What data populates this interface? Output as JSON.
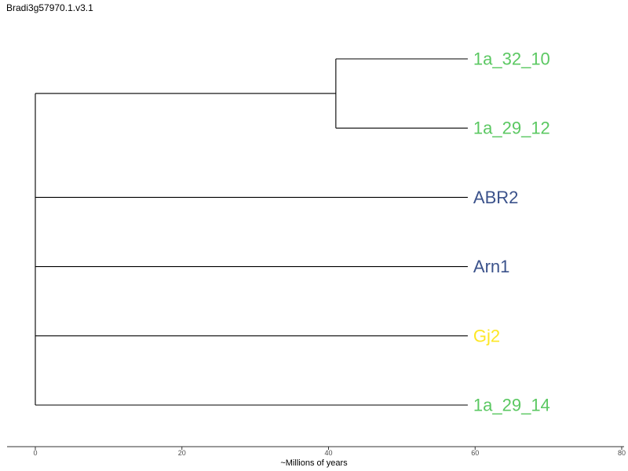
{
  "title": "Bradi3g57970.1.v3.1",
  "axis": {
    "label": "~Millions of years",
    "min": 0,
    "max": 80,
    "ticks": [
      0,
      20,
      40,
      60,
      80
    ]
  },
  "tips": [
    {
      "name": "1a_32_10",
      "color": "#5bc862"
    },
    {
      "name": "1a_29_12",
      "color": "#5bc862"
    },
    {
      "name": "ABR2",
      "color": "#3b528b"
    },
    {
      "name": "Arn1",
      "color": "#3b528b"
    },
    {
      "name": "Gj2",
      "color": "#fde725"
    },
    {
      "name": "1a_29_14",
      "color": "#5bc862"
    }
  ],
  "tree": {
    "root": {
      "time": 0,
      "children": [
        {
          "time": 41,
          "children": [
            {
              "tip": 0,
              "time": 59
            },
            {
              "tip": 1,
              "time": 59
            }
          ]
        },
        {
          "tip": 2,
          "time": 59
        },
        {
          "tip": 3,
          "time": 59
        },
        {
          "tip": 4,
          "time": 59
        },
        {
          "tip": 5,
          "time": 59
        }
      ]
    }
  }
}
